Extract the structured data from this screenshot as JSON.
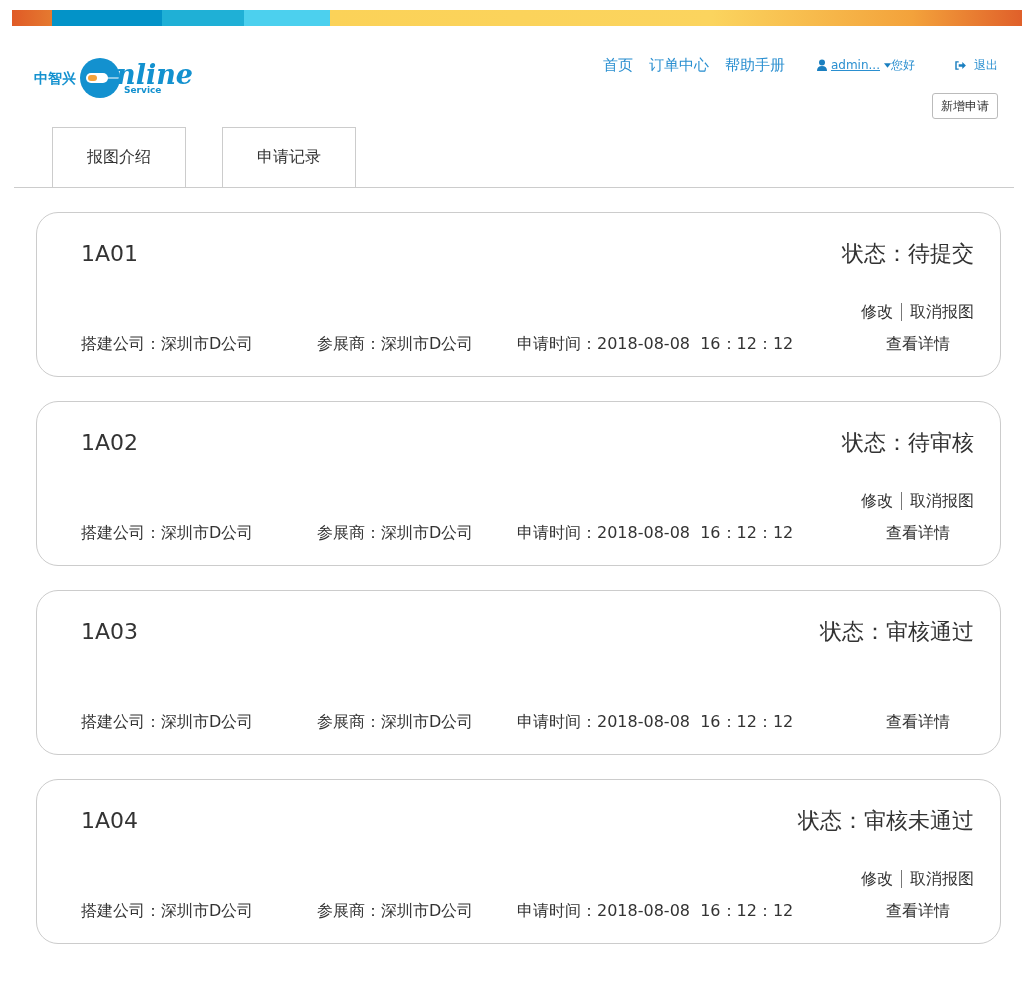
{
  "logo": {
    "brand": "中智兴",
    "word": "nline",
    "subtitle": "Service"
  },
  "nav": {
    "links": [
      "首页",
      "订单中心",
      "帮助手册"
    ],
    "user": "admin...",
    "greeting": "您好",
    "logout": "退出"
  },
  "new_button": "新增申请",
  "tabs": [
    {
      "label": "报图介绍"
    },
    {
      "label": "申请记录"
    }
  ],
  "records": [
    {
      "code": "1A01",
      "status": "状态：待提交",
      "actions": [
        "修改",
        "取消报图"
      ],
      "builder": "搭建公司：深圳市D公司",
      "exhibitor": "参展商：深圳市D公司",
      "time": "申请时间：2018-08-08  16：12：12",
      "details": "查看详情"
    },
    {
      "code": "1A02",
      "status": "状态：待审核",
      "actions": [
        "修改",
        "取消报图"
      ],
      "builder": "搭建公司：深圳市D公司",
      "exhibitor": "参展商：深圳市D公司",
      "time": "申请时间：2018-08-08  16：12：12",
      "details": "查看详情"
    },
    {
      "code": "1A03",
      "status": "状态：审核通过",
      "builder": "搭建公司：深圳市D公司",
      "exhibitor": "参展商：深圳市D公司",
      "time": "申请时间：2018-08-08  16：12：12",
      "details": "查看详情"
    },
    {
      "code": "1A04",
      "status": "状态：审核未通过",
      "actions": [
        "修改",
        "取消报图"
      ],
      "builder": "搭建公司：深圳市D公司",
      "exhibitor": "参展商：深圳市D公司",
      "time": "申请时间：2018-08-08  16：12：12",
      "details": "查看详情"
    }
  ]
}
